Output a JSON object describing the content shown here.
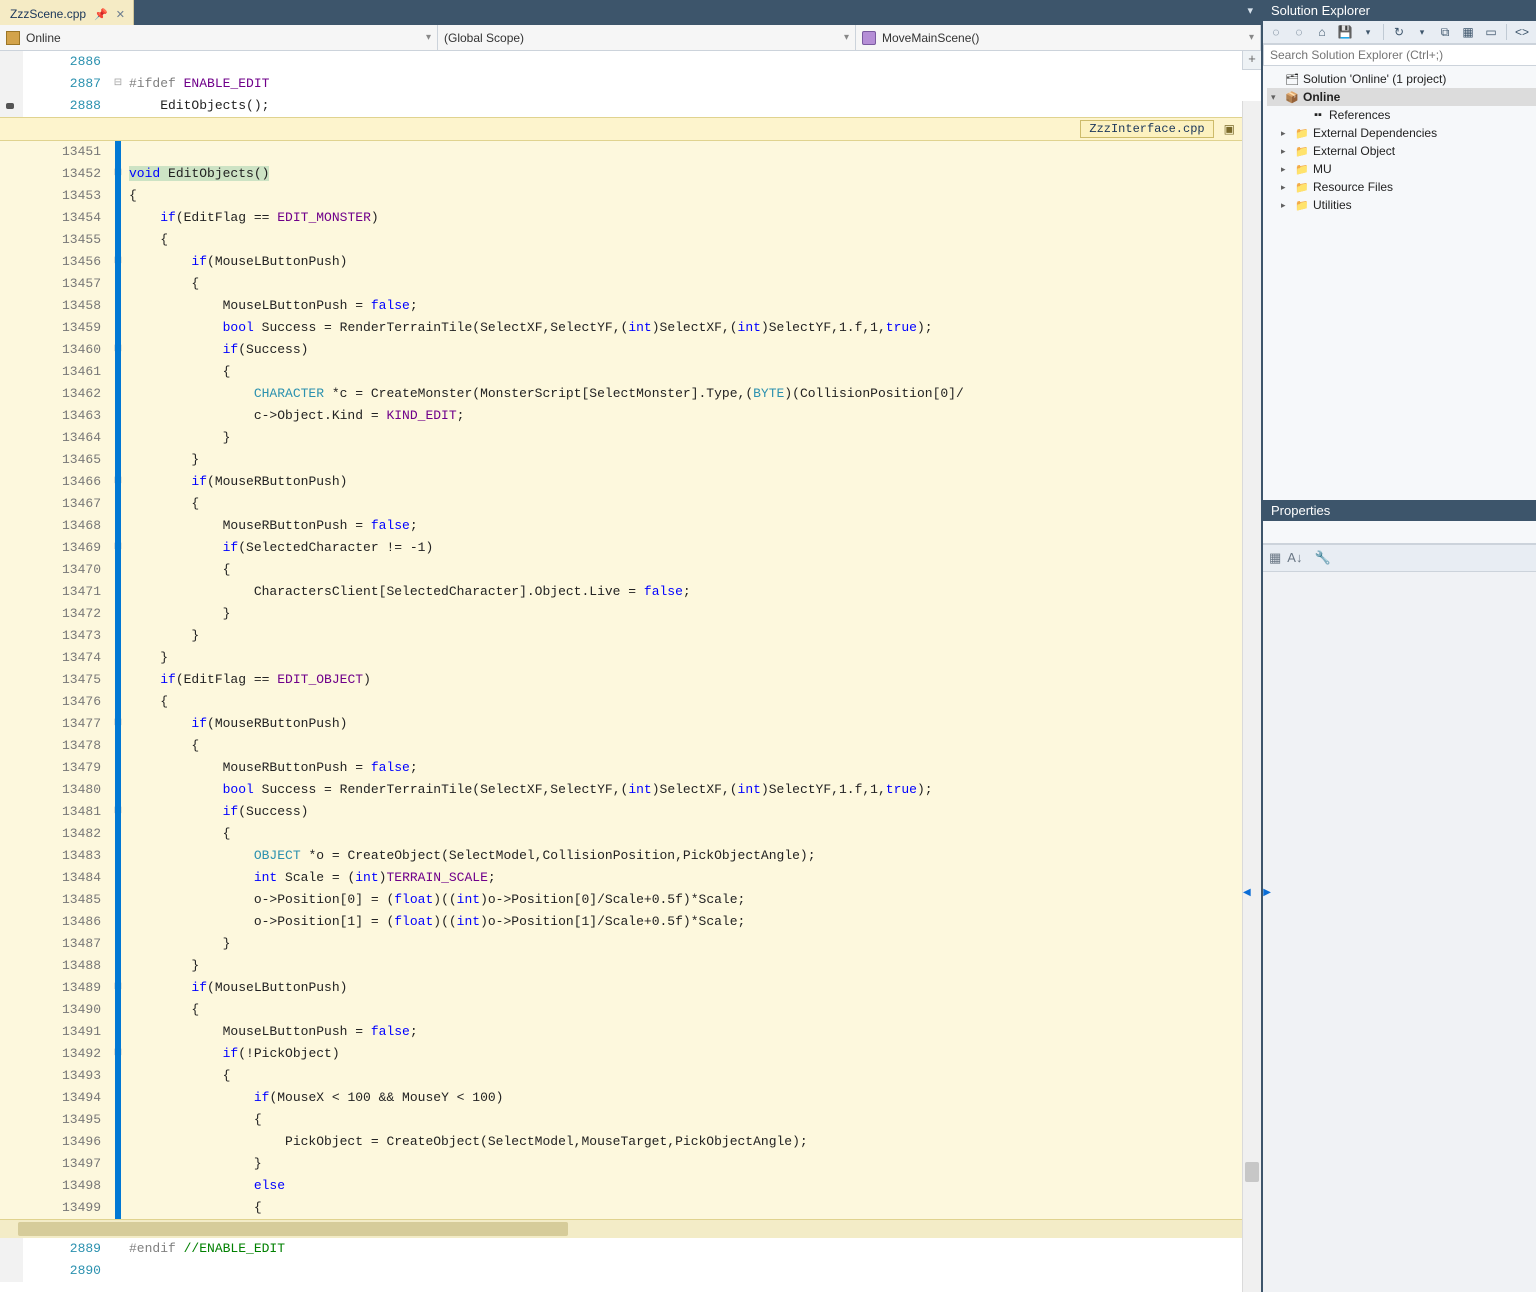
{
  "tabs": {
    "active_file": "ZzzScene.cpp"
  },
  "nav": {
    "project": "Online",
    "scope": "(Global Scope)",
    "func": "MoveMainScene()"
  },
  "upper_lines": {
    "l2886": "2886",
    "l2887": "2887",
    "l2887_code_a": "#ifdef",
    "l2887_code_b": " ENABLE_EDIT",
    "l2888": "2888",
    "l2888_code": "    EditObjects();"
  },
  "peek": {
    "file": "ZzzInterface.cpp",
    "line_start": 13451,
    "sig_kw": "void",
    "sig_name": " EditObjects()",
    "code": {
      "13451": "",
      "13452": "",
      "13453": "{",
      "13454_a": "    ",
      "13454_if": "if",
      "13454_b": "(EditFlag == ",
      "13454_m": "EDIT_MONSTER",
      "13454_c": ")",
      "13455": "    {",
      "13456_a": "        ",
      "13456_if": "if",
      "13456_b": "(MouseLButtonPush)",
      "13457": "        {",
      "13458_a": "            MouseLButtonPush = ",
      "13458_kw": "false",
      "13458_b": ";",
      "13459_a": "            ",
      "13459_t": "bool",
      "13459_b": " Success = RenderTerrainTile(SelectXF,SelectYF,(",
      "13459_c": "int",
      "13459_d": ")SelectXF,(",
      "13459_e": "int",
      "13459_f": ")SelectYF,1.f,1,",
      "13459_g": "true",
      "13459_h": ");",
      "13460_a": "            ",
      "13460_if": "if",
      "13460_b": "(Success)",
      "13461": "            {",
      "13462_a": "                ",
      "13462_t": "CHARACTER",
      "13462_b": " *c = CreateMonster(MonsterScript[SelectMonster].Type,(",
      "13462_c": "BYTE",
      "13462_d": ")(CollisionPosition[0]/",
      "13463_a": "                c->Object.Kind = ",
      "13463_m": "KIND_EDIT",
      "13463_b": ";",
      "13464": "            }",
      "13465": "        }",
      "13466_a": "        ",
      "13466_if": "if",
      "13466_b": "(MouseRButtonPush)",
      "13467": "        {",
      "13468_a": "            MouseRButtonPush = ",
      "13468_kw": "false",
      "13468_b": ";",
      "13469_a": "            ",
      "13469_if": "if",
      "13469_b": "(SelectedCharacter != -1)",
      "13470": "            {",
      "13471_a": "                CharactersClient[SelectedCharacter].Object.Live = ",
      "13471_kw": "false",
      "13471_b": ";",
      "13472": "            }",
      "13473": "        }",
      "13474": "    }",
      "13475_a": "    ",
      "13475_if": "if",
      "13475_b": "(EditFlag == ",
      "13475_m": "EDIT_OBJECT",
      "13475_c": ")",
      "13476": "    {",
      "13477_a": "        ",
      "13477_if": "if",
      "13477_b": "(MouseRButtonPush)",
      "13478": "        {",
      "13479_a": "            MouseRButtonPush = ",
      "13479_kw": "false",
      "13479_b": ";",
      "13480_a": "            ",
      "13480_t": "bool",
      "13480_b": " Success = RenderTerrainTile(SelectXF,SelectYF,(",
      "13480_c": "int",
      "13480_d": ")SelectXF,(",
      "13480_e": "int",
      "13480_f": ")SelectYF,1.f,1,",
      "13480_g": "true",
      "13480_h": ");",
      "13481_a": "            ",
      "13481_if": "if",
      "13481_b": "(Success)",
      "13482": "            {",
      "13483_a": "                ",
      "13483_t": "OBJECT",
      "13483_b": " *o = CreateObject(SelectModel,CollisionPosition,PickObjectAngle);",
      "13484_a": "                ",
      "13484_t": "int",
      "13484_b": " Scale = (",
      "13484_c": "int",
      "13484_d": ")",
      "13484_m": "TERRAIN_SCALE",
      "13484_e": ";",
      "13485_a": "                o->Position[0] = (",
      "13485_t": "float",
      "13485_b": ")((",
      "13485_c": "int",
      "13485_d": ")o->Position[0]/Scale+0.5f)*Scale;",
      "13486_a": "                o->Position[1] = (",
      "13486_t": "float",
      "13486_b": ")((",
      "13486_c": "int",
      "13486_d": ")o->Position[1]/Scale+0.5f)*Scale;",
      "13487": "            }",
      "13488": "        }",
      "13489_a": "        ",
      "13489_if": "if",
      "13489_b": "(MouseLButtonPush)",
      "13490": "        {",
      "13491_a": "            MouseLButtonPush = ",
      "13491_kw": "false",
      "13491_b": ";",
      "13492_a": "            ",
      "13492_if": "if",
      "13492_b": "(!PickObject)",
      "13493": "            {",
      "13494_a": "                ",
      "13494_if": "if",
      "13494_b": "(MouseX < 100 && MouseY < 100)",
      "13495": "                {",
      "13496": "                    PickObject = CreateObject(SelectModel,MouseTarget,PickObjectAngle);",
      "13497": "                }",
      "13498_a": "                ",
      "13498_kw": "else",
      "13499": "                {"
    }
  },
  "lower_lines": {
    "l2889": "2889",
    "l2889_a": "#endif ",
    "l2889_b": "//ENABLE_EDIT",
    "l2890": "2890"
  },
  "solution_explorer": {
    "title": "Solution Explorer",
    "search_placeholder": "Search Solution Explorer (Ctrl+;)",
    "root": "Solution 'Online' (1 project)",
    "project": "Online",
    "items": {
      "references": "References",
      "ext_deps": "External Dependencies",
      "ext_obj": "External Object",
      "mu": "MU",
      "res": "Resource Files",
      "util": "Utilities"
    }
  },
  "properties": {
    "title": "Properties"
  }
}
